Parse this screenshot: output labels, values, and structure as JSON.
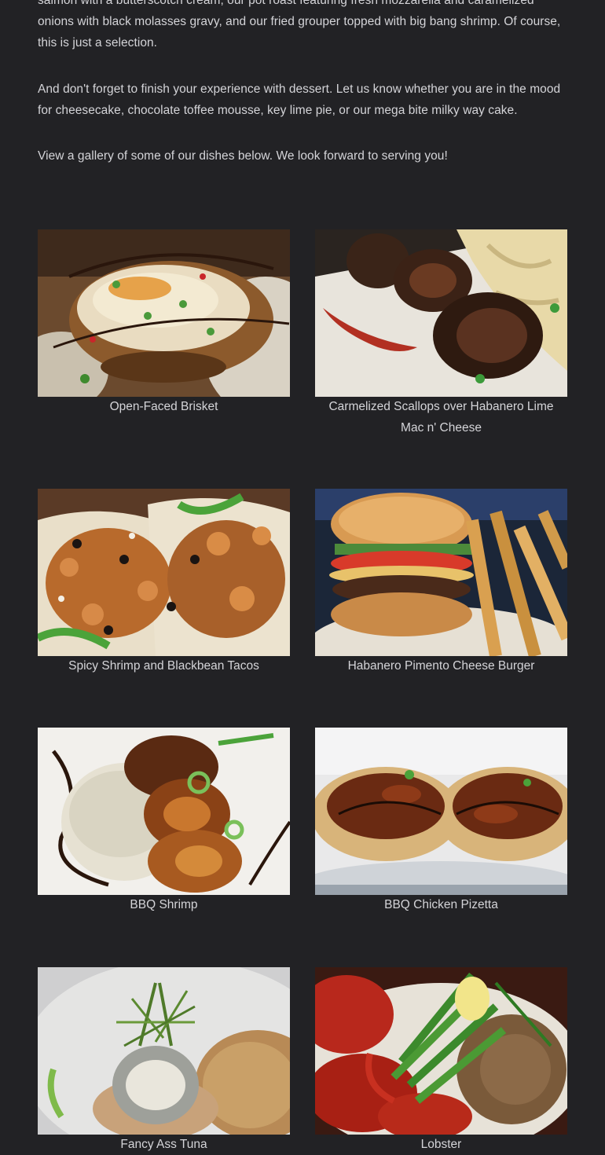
{
  "intro": {
    "paragraph_1": "salmon with a butterscotch cream, our pot roast featuring fresh mozzarella and caramelized onions with black molasses gravy, and our fried grouper topped with big bang shrimp. Of course, this is just a selection.",
    "paragraph_2": "And don't forget to finish your experience with dessert. Let us know whether you are in the mood for cheesecake, chocolate toffee mousse, key lime pie, or our mega bite milky way cake.",
    "paragraph_3": "View a gallery of some of our dishes below. We look forward to serving you!"
  },
  "gallery": [
    {
      "caption": "Open-Faced Brisket",
      "icon": "brisket-photo"
    },
    {
      "caption": "Carmelized Scallops over Habanero Lime Mac n' Cheese",
      "icon": "scallops-photo"
    },
    {
      "caption": "Spicy Shrimp and Blackbean Tacos",
      "icon": "tacos-photo"
    },
    {
      "caption": "Habanero Pimento Cheese Burger",
      "icon": "burger-photo"
    },
    {
      "caption": "BBQ Shrimp",
      "icon": "bbq-shrimp-photo"
    },
    {
      "caption": "BBQ Chicken Pizetta",
      "icon": "pizetta-photo"
    },
    {
      "caption": "Fancy Ass Tuna",
      "icon": "tuna-photo"
    },
    {
      "caption": "Lobster",
      "icon": "lobster-photo"
    }
  ],
  "colors": {
    "background": "#222225",
    "text": "#d4d4d8"
  }
}
